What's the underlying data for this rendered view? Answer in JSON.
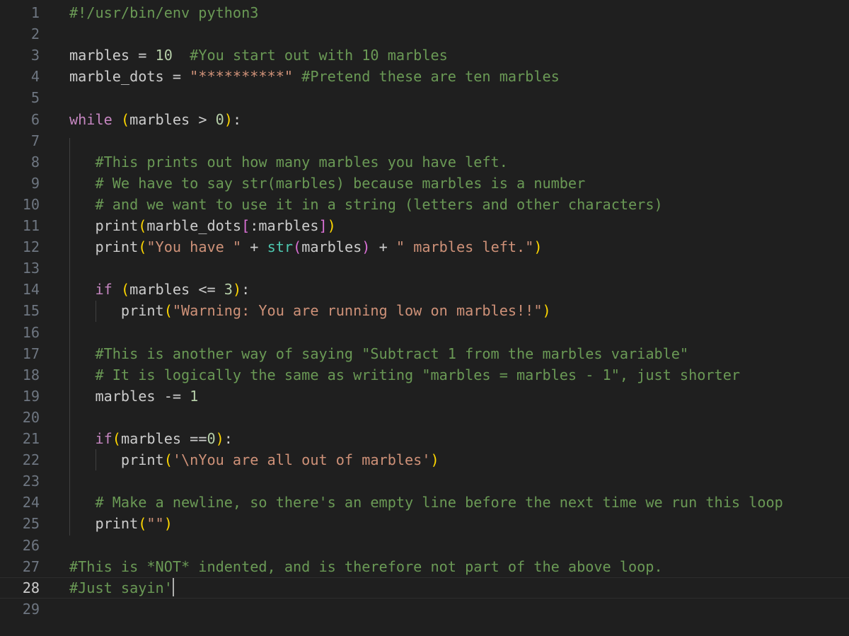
{
  "theme": {
    "background": "#1f1f1f",
    "line_number": "#6e7681",
    "line_number_active": "#cccccc",
    "colors": {
      "text": "#cccccc",
      "comment": "#6a9955",
      "keyword": "#c586c0",
      "string": "#ce9178",
      "number": "#b5cea8",
      "builtin": "#4ec9b0",
      "paren": "#ffd700",
      "bracket": "#da70d6"
    }
  },
  "editor": {
    "language": "python",
    "active_line": 28,
    "lines": [
      {
        "n": "1",
        "tokens": [
          [
            "comment",
            "#!/usr/bin/env python3"
          ]
        ]
      },
      {
        "n": "2",
        "tokens": []
      },
      {
        "n": "3",
        "tokens": [
          [
            "text",
            "marbles = "
          ],
          [
            "number",
            "10"
          ],
          [
            "text",
            "  "
          ],
          [
            "comment",
            "#You start out with 10 marbles"
          ]
        ]
      },
      {
        "n": "4",
        "tokens": [
          [
            "text",
            "marble_dots = "
          ],
          [
            "string",
            "\"**********\""
          ],
          [
            "text",
            " "
          ],
          [
            "comment",
            "#Pretend these are ten marbles"
          ]
        ]
      },
      {
        "n": "5",
        "tokens": []
      },
      {
        "n": "6",
        "tokens": [
          [
            "keyword",
            "while"
          ],
          [
            "text",
            " "
          ],
          [
            "paren",
            "("
          ],
          [
            "text",
            "marbles > "
          ],
          [
            "number",
            "0"
          ],
          [
            "paren",
            ")"
          ],
          [
            "text",
            ":"
          ]
        ]
      },
      {
        "n": "7",
        "tokens": []
      },
      {
        "n": "8",
        "tokens": [
          [
            "text",
            "   "
          ],
          [
            "comment",
            "#This prints out how many marbles you have left."
          ]
        ]
      },
      {
        "n": "9",
        "tokens": [
          [
            "text",
            "   "
          ],
          [
            "comment",
            "# We have to say str(marbles) because marbles is a number"
          ]
        ]
      },
      {
        "n": "10",
        "tokens": [
          [
            "text",
            "   "
          ],
          [
            "comment",
            "# and we want to use it in a string (letters and other characters)"
          ]
        ]
      },
      {
        "n": "11",
        "tokens": [
          [
            "text",
            "   print"
          ],
          [
            "paren",
            "("
          ],
          [
            "text",
            "marble_dots"
          ],
          [
            "bracket",
            "["
          ],
          [
            "text",
            ":marbles"
          ],
          [
            "bracket",
            "]"
          ],
          [
            "paren",
            ")"
          ]
        ]
      },
      {
        "n": "12",
        "tokens": [
          [
            "text",
            "   print"
          ],
          [
            "paren",
            "("
          ],
          [
            "string",
            "\"You have \""
          ],
          [
            "text",
            " + "
          ],
          [
            "builtin",
            "str"
          ],
          [
            "bracket",
            "("
          ],
          [
            "text",
            "marbles"
          ],
          [
            "bracket",
            ")"
          ],
          [
            "text",
            " + "
          ],
          [
            "string",
            "\" marbles left.\""
          ],
          [
            "paren",
            ")"
          ]
        ]
      },
      {
        "n": "13",
        "tokens": []
      },
      {
        "n": "14",
        "tokens": [
          [
            "text",
            "   "
          ],
          [
            "keyword",
            "if"
          ],
          [
            "text",
            " "
          ],
          [
            "paren",
            "("
          ],
          [
            "text",
            "marbles <= "
          ],
          [
            "number",
            "3"
          ],
          [
            "paren",
            ")"
          ],
          [
            "text",
            ":"
          ]
        ]
      },
      {
        "n": "15",
        "tokens": [
          [
            "text",
            "      print"
          ],
          [
            "paren",
            "("
          ],
          [
            "string",
            "\"Warning: You are running low on marbles!!\""
          ],
          [
            "paren",
            ")"
          ]
        ]
      },
      {
        "n": "16",
        "tokens": []
      },
      {
        "n": "17",
        "tokens": [
          [
            "text",
            "   "
          ],
          [
            "comment",
            "#This is another way of saying \"Subtract 1 from the marbles variable\""
          ]
        ]
      },
      {
        "n": "18",
        "tokens": [
          [
            "text",
            "   "
          ],
          [
            "comment",
            "# It is logically the same as writing \"marbles = marbles - 1\", just shorter"
          ]
        ]
      },
      {
        "n": "19",
        "tokens": [
          [
            "text",
            "   marbles -= "
          ],
          [
            "number",
            "1"
          ]
        ]
      },
      {
        "n": "20",
        "tokens": []
      },
      {
        "n": "21",
        "tokens": [
          [
            "text",
            "   "
          ],
          [
            "keyword",
            "if"
          ],
          [
            "paren",
            "("
          ],
          [
            "text",
            "marbles =="
          ],
          [
            "number",
            "0"
          ],
          [
            "paren",
            ")"
          ],
          [
            "text",
            ":"
          ]
        ]
      },
      {
        "n": "22",
        "tokens": [
          [
            "text",
            "      print"
          ],
          [
            "paren",
            "("
          ],
          [
            "string",
            "'\\nYou are all out of marbles'"
          ],
          [
            "paren",
            ")"
          ]
        ]
      },
      {
        "n": "23",
        "tokens": []
      },
      {
        "n": "24",
        "tokens": [
          [
            "text",
            "   "
          ],
          [
            "comment",
            "# Make a newline, so there's an empty line before the next time we run this loop"
          ]
        ]
      },
      {
        "n": "25",
        "tokens": [
          [
            "text",
            "   print"
          ],
          [
            "paren",
            "("
          ],
          [
            "string",
            "\"\""
          ],
          [
            "paren",
            ")"
          ]
        ]
      },
      {
        "n": "26",
        "tokens": []
      },
      {
        "n": "27",
        "tokens": [
          [
            "comment",
            "#This is *NOT* indented, and is therefore not part of the above loop."
          ]
        ]
      },
      {
        "n": "28",
        "tokens": [
          [
            "comment",
            "#Just sayin'"
          ]
        ]
      },
      {
        "n": "29",
        "tokens": []
      }
    ]
  }
}
